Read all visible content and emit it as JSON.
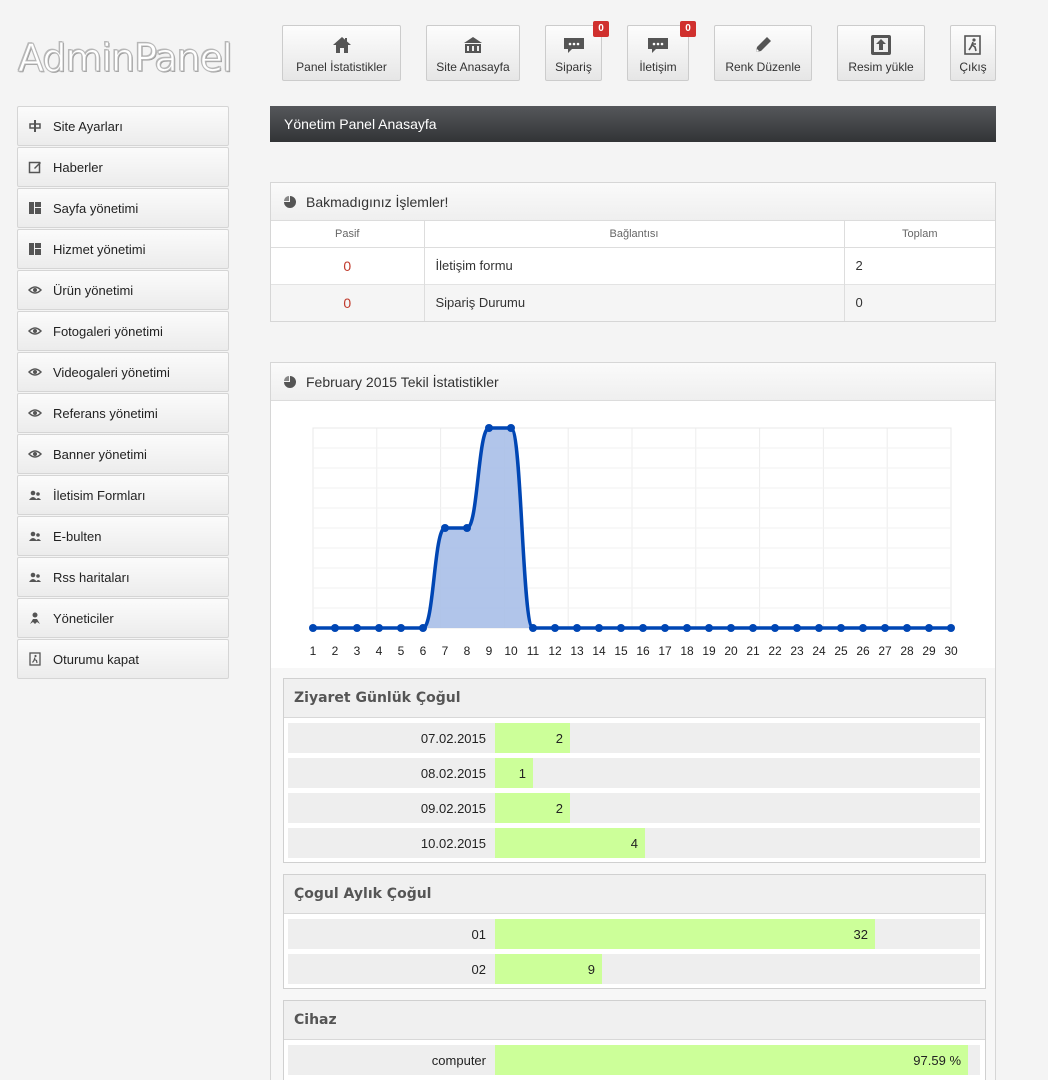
{
  "logo": "AdminPanel",
  "topnav": [
    {
      "label": "Panel İstatistikler",
      "icon": "home-icon"
    },
    {
      "label": "Site Anasayfa",
      "icon": "building-icon"
    },
    {
      "label": "Sipariş",
      "icon": "comment-icon",
      "badge": "0"
    },
    {
      "label": "İletişim",
      "icon": "comment-icon",
      "badge": "0"
    },
    {
      "label": "Renk Düzenle",
      "icon": "pencil-icon"
    },
    {
      "label": "Resim yükle",
      "icon": "upload-icon"
    },
    {
      "label": "Çıkış",
      "icon": "exit-icon"
    }
  ],
  "sidebar": [
    {
      "label": "Site Ayarları",
      "icon": "settings-icon"
    },
    {
      "label": "Haberler",
      "icon": "edit-icon"
    },
    {
      "label": "Sayfa yönetimi",
      "icon": "layout-icon"
    },
    {
      "label": "Hizmet yönetimi",
      "icon": "layout-icon"
    },
    {
      "label": "Ürün yönetimi",
      "icon": "eye-icon"
    },
    {
      "label": "Fotogaleri yönetimi",
      "icon": "eye-icon"
    },
    {
      "label": "Videogaleri yönetimi",
      "icon": "eye-icon"
    },
    {
      "label": "Referans yönetimi",
      "icon": "eye-icon"
    },
    {
      "label": "Banner yönetimi",
      "icon": "eye-icon"
    },
    {
      "label": "İletisim Formları",
      "icon": "users-icon"
    },
    {
      "label": "E-bulten",
      "icon": "users-icon"
    },
    {
      "label": "Rss haritaları",
      "icon": "users-icon"
    },
    {
      "label": "Yöneticiler",
      "icon": "admin-icon"
    },
    {
      "label": "Oturumu kapat",
      "icon": "exit-icon"
    }
  ],
  "page_title": "Yönetim Panel Anasayfa",
  "pending": {
    "title": "Bakmadıgınız İşlemler!",
    "columns": [
      "Pasif",
      "Bağlantısı",
      "Toplam"
    ],
    "rows": [
      {
        "pasif": "0",
        "link": "İletişim formu",
        "total": "2"
      },
      {
        "pasif": "0",
        "link": "Sipariş Durumu",
        "total": "0"
      }
    ]
  },
  "stats": {
    "title": "February 2015 Tekil İstatistikler",
    "daily": {
      "title": "Ziyaret Günlük Çoğul",
      "rows": [
        {
          "label": "07.02.2015",
          "value": "2",
          "fraction": 0.155
        },
        {
          "label": "08.02.2015",
          "value": "1",
          "fraction": 0.078
        },
        {
          "label": "09.02.2015",
          "value": "2",
          "fraction": 0.155
        },
        {
          "label": "10.02.2015",
          "value": "4",
          "fraction": 0.31
        }
      ]
    },
    "monthly": {
      "title": "Çogul Aylık Çoğul",
      "rows": [
        {
          "label": "01",
          "value": "32",
          "fraction": 0.784
        },
        {
          "label": "02",
          "value": "9",
          "fraction": 0.22
        }
      ]
    },
    "device": {
      "title": "Cihaz",
      "rows": [
        {
          "label": "computer",
          "value": "97.59 %",
          "fraction": 0.9759
        }
      ]
    }
  },
  "chart_data": {
    "type": "area",
    "x": [
      1,
      2,
      3,
      4,
      5,
      6,
      7,
      8,
      9,
      10,
      11,
      12,
      13,
      14,
      15,
      16,
      17,
      18,
      19,
      20,
      21,
      22,
      23,
      24,
      25,
      26,
      27,
      28,
      29,
      30
    ],
    "values": [
      0,
      0,
      0,
      0,
      0,
      0,
      2,
      2,
      4,
      4,
      0,
      0,
      0,
      0,
      0,
      0,
      0,
      0,
      0,
      0,
      0,
      0,
      0,
      0,
      0,
      0,
      0,
      0,
      0,
      0
    ],
    "ylim": [
      0,
      4
    ],
    "grid": true,
    "color": "#0046b4",
    "fill": "#a8bfe8"
  }
}
